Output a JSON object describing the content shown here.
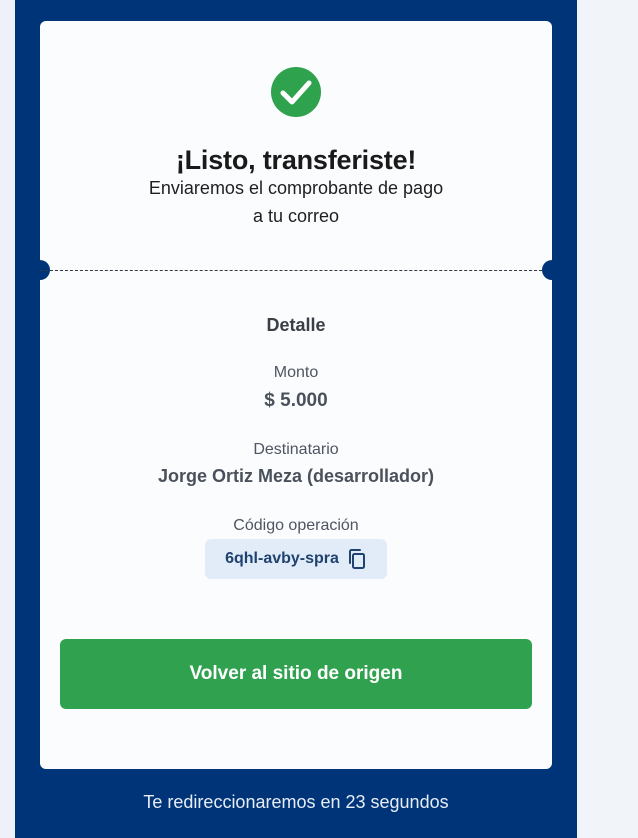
{
  "success": {
    "title": "¡Listo, transferiste!",
    "subtitle_line1": "Enviaremos el comprobante de pago",
    "subtitle_line2": "a tu correo"
  },
  "detail": {
    "title": "Detalle",
    "amount_label": "Monto",
    "amount_value": "$ 5.000",
    "recipient_label": "Destinatario",
    "recipient_value": "Jorge Ortiz Meza (desarrollador)",
    "operation_label": "Código operación",
    "operation_code": "6qhl-avby-spra"
  },
  "actions": {
    "back_label": "Volver al sitio de origen"
  },
  "footer": {
    "redirect_text": "Te redireccionaremos en 23 segundos"
  },
  "colors": {
    "panel": "#003479",
    "success": "#30a24f",
    "chip": "#e2ecf8"
  },
  "icons": {
    "success": "check-circle-icon",
    "copy": "copy-icon"
  }
}
